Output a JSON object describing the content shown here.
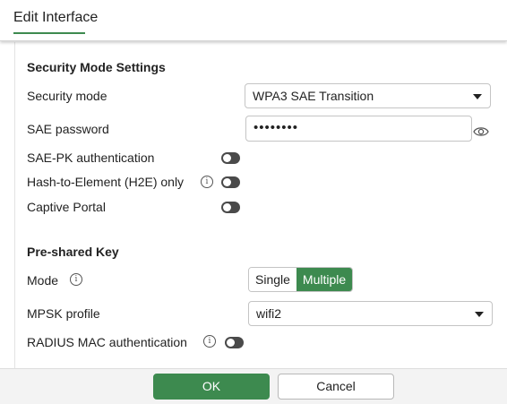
{
  "header": {
    "title": "Edit Interface"
  },
  "security": {
    "section_title": "Security Mode Settings",
    "mode_label": "Security mode",
    "mode_value": "WPA3 SAE Transition",
    "sae_password_label": "SAE password",
    "sae_password_masked": "••••••••",
    "sae_pk_label": "SAE-PK authentication",
    "h2e_label": "Hash-to-Element (H2E) only",
    "captive_portal_label": "Captive Portal"
  },
  "psk": {
    "section_title": "Pre-shared Key",
    "mode_label": "Mode",
    "mode_options": [
      "Single",
      "Multiple"
    ],
    "mode_selected": "Multiple",
    "mpsk_profile_label": "MPSK profile",
    "mpsk_profile_value": "wifi2",
    "radius_mac_label": "RADIUS MAC authentication"
  },
  "footer": {
    "ok_label": "OK",
    "cancel_label": "Cancel"
  },
  "colors": {
    "accent": "#3d8a4f",
    "toggle_off": "#4a4a4a"
  },
  "icons": {
    "info": "info-icon",
    "eye": "eye-icon",
    "caret": "chevron-down-icon"
  }
}
